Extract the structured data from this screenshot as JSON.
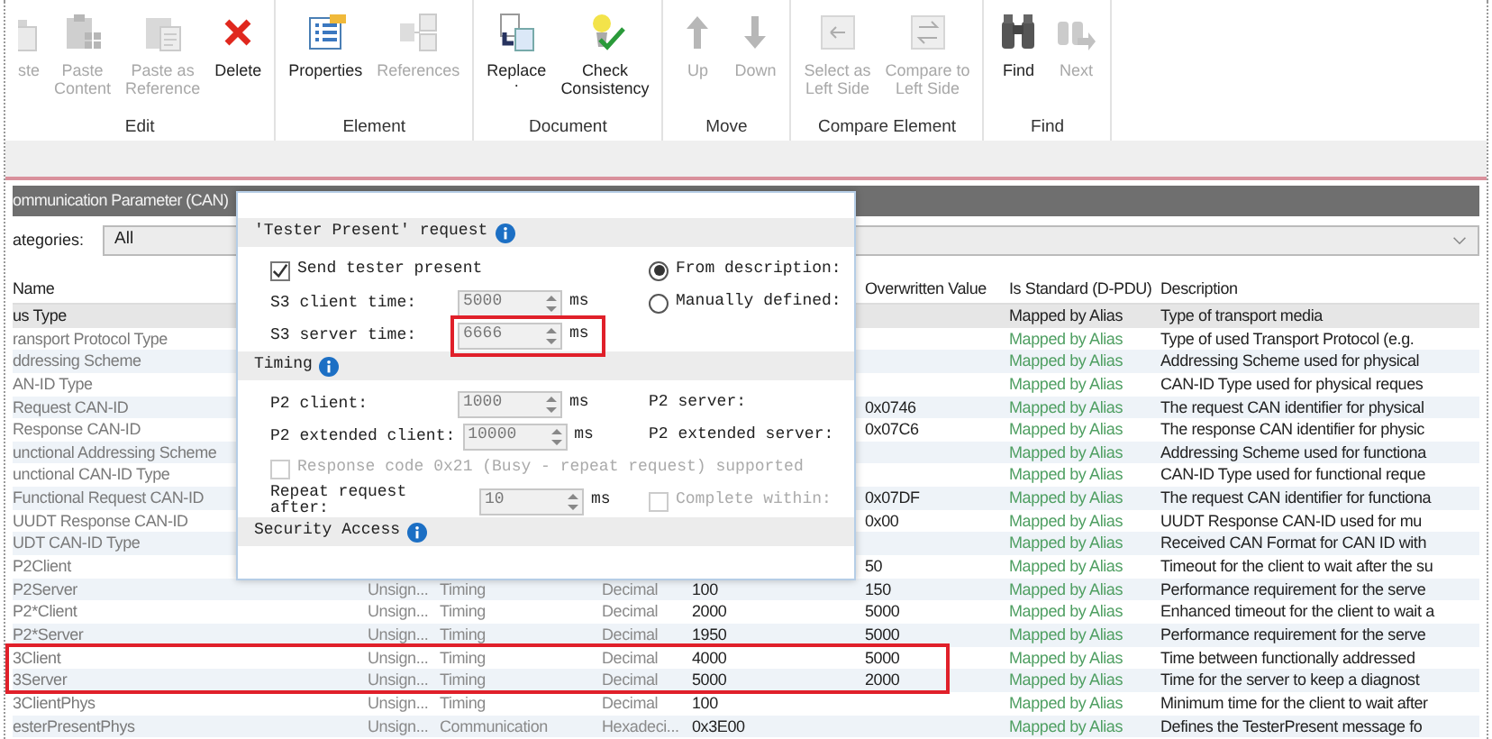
{
  "ribbon": {
    "groups": [
      {
        "label": "Edit",
        "buttons": [
          {
            "label": "ste",
            "disabled": true
          },
          {
            "label": "Paste\nContent",
            "disabled": true
          },
          {
            "label": "Paste as\nReference",
            "disabled": true
          },
          {
            "label": "Delete",
            "disabled": false
          }
        ]
      },
      {
        "label": "Element",
        "buttons": [
          {
            "label": "Properties",
            "disabled": false
          },
          {
            "label": "References",
            "disabled": true
          }
        ]
      },
      {
        "label": "Document",
        "buttons": [
          {
            "label": "Replace",
            "marker": "·",
            "disabled": false
          },
          {
            "label": "Check\nConsistency",
            "disabled": false
          }
        ]
      },
      {
        "label": "Move",
        "buttons": [
          {
            "label": "Up",
            "disabled": true
          },
          {
            "label": "Down",
            "disabled": true
          }
        ]
      },
      {
        "label": "Compare Element",
        "buttons": [
          {
            "label": "Select as\nLeft Side",
            "disabled": true
          },
          {
            "label": "Compare to\nLeft Side",
            "disabled": true
          }
        ]
      },
      {
        "label": "Find",
        "buttons": [
          {
            "label": "Find",
            "disabled": false
          },
          {
            "label": "Next",
            "disabled": true
          }
        ]
      }
    ]
  },
  "panel": {
    "title": "ommunication Parameter (CAN)",
    "categories_label": "ategories:",
    "categories_value": "All"
  },
  "table": {
    "columns": [
      "Name",
      "Overwritten Value",
      "Is Standard (D-PDU)",
      "Description"
    ],
    "rows": [
      {
        "name": "us Type",
        "standard": "Mapped by Alias",
        "description": "Type of transport media",
        "inherited": false,
        "selected": true
      },
      {
        "name": "ransport Protocol Type",
        "standard": "Mapped by Alias",
        "description": "Type of used Transport Protocol (e.g.",
        "inherited": true,
        "selected": false
      },
      {
        "name": "ddressing Scheme",
        "standard": "Mapped by Alias",
        "description": "Addressing Scheme used for physical",
        "inherited": true,
        "selected": false
      },
      {
        "name": "AN-ID Type",
        "standard": "Mapped by Alias",
        "description": "CAN-ID Type used for physical reques",
        "inherited": true,
        "selected": false
      },
      {
        "name": "Request CAN-ID",
        "overwritten": "0x0746",
        "standard": "Mapped by Alias",
        "description": "The request CAN identifier for physical",
        "inherited": true,
        "selected": false
      },
      {
        "name": "Response CAN-ID",
        "overwritten": "0x07C6",
        "standard": "Mapped by Alias",
        "description": "The response CAN identifier for physic",
        "inherited": true,
        "selected": false
      },
      {
        "name": "unctional Addressing Scheme",
        "standard": "Mapped by Alias",
        "description": "Addressing Scheme used for functiona",
        "inherited": true,
        "selected": false
      },
      {
        "name": "unctional CAN-ID Type",
        "standard": "Mapped by Alias",
        "description": "CAN-ID Type used for functional reque",
        "inherited": true,
        "selected": false
      },
      {
        "name": "Functional Request CAN-ID",
        "overwritten": "0x07DF",
        "standard": "Mapped by Alias",
        "description": "The request CAN identifier for functiona",
        "inherited": true,
        "selected": false
      },
      {
        "name": "UUDT Response CAN-ID",
        "overwritten": "0x00",
        "standard": "Mapped by Alias",
        "description": "UUDT Response CAN-ID used for mu",
        "inherited": true,
        "selected": false
      },
      {
        "name": "UDT CAN-ID Type",
        "standard": "Mapped by Alias",
        "description": "Received CAN Format for CAN ID with",
        "inherited": true,
        "selected": false
      },
      {
        "name": "P2Client",
        "overwritten": "50",
        "standard": "Mapped by Alias",
        "description": "Timeout for the client to wait after the su",
        "inherited": true,
        "selected": false
      },
      {
        "name": "P2Server",
        "type": "Unsign...",
        "category": "Timing",
        "format": "Decimal",
        "value": "100",
        "overwritten": "150",
        "standard": "Mapped by Alias",
        "description": "Performance requirement for the serve",
        "inherited": true,
        "selected": false
      },
      {
        "name": "P2*Client",
        "type": "Unsign...",
        "category": "Timing",
        "format": "Decimal",
        "value": "2000",
        "overwritten": "5000",
        "standard": "Mapped by Alias",
        "description": "Enhanced timeout for the client to wait a",
        "inherited": true,
        "selected": false
      },
      {
        "name": "P2*Server",
        "type": "Unsign...",
        "category": "Timing",
        "format": "Decimal",
        "value": "1950",
        "overwritten": "5000",
        "standard": "Mapped by Alias",
        "description": "Performance requirement for the serve",
        "inherited": true,
        "selected": false
      },
      {
        "name": "3Client",
        "type": "Unsign...",
        "category": "Timing",
        "format": "Decimal",
        "value": "4000",
        "overwritten": "5000",
        "standard": "Mapped by Alias",
        "description": "Time between functionally addressed",
        "inherited": true,
        "selected": false
      },
      {
        "name": "3Server",
        "type": "Unsign...",
        "category": "Timing",
        "format": "Decimal",
        "value": "5000",
        "overwritten": "2000",
        "standard": "Mapped by Alias",
        "description": "Time for the server to keep a diagnost",
        "inherited": true,
        "selected": false
      },
      {
        "name": "3ClientPhys",
        "type": "Unsign...",
        "category": "Timing",
        "format": "Decimal",
        "value": "100",
        "standard": "Mapped by Alias",
        "description": "Minimum time for the client to wait after",
        "inherited": true,
        "selected": false
      },
      {
        "name": "esterPresentPhys",
        "type": "Unsign...",
        "category": "Communication",
        "format": "Hexadeci...",
        "value": "0x3E00",
        "standard": "Mapped by Alias",
        "description": "Defines the TesterPresent message fo",
        "inherited": true,
        "selected": false
      }
    ]
  },
  "dialog": {
    "sections": [
      {
        "title": "'Tester Present' request",
        "rows": [
          [
            {
              "kind": "checkbox",
              "label": "Send tester present",
              "checked": true,
              "disabled": false
            },
            {
              "kind": "radio",
              "label": "From description:",
              "selected": true
            }
          ],
          [
            {
              "kind": "spin",
              "label": "S3 client time:",
              "value": "5000",
              "unit": "ms"
            },
            {
              "kind": "radio",
              "label": "Manually defined:",
              "selected": false
            }
          ],
          [
            {
              "kind": "spin",
              "label": "S3 server time:",
              "value": "6666",
              "unit": "ms"
            }
          ]
        ]
      },
      {
        "title": "Timing",
        "rows": [
          [
            {
              "kind": "spin",
              "label": "P2 client:",
              "value": "1000",
              "unit": "ms"
            },
            {
              "kind": "text",
              "label": "P2 server:"
            }
          ],
          [
            {
              "kind": "spin",
              "label": "P2 extended client:",
              "value": "10000",
              "unit": "ms"
            },
            {
              "kind": "text",
              "label": "P2 extended server:"
            }
          ],
          [
            {
              "kind": "checkbox",
              "label": "Response code 0x21 (Busy - repeat request) supported",
              "checked": false,
              "disabled": true
            }
          ],
          [
            {
              "kind": "spin",
              "label": "Repeat request after:",
              "value": "10",
              "unit": "ms"
            },
            {
              "kind": "checkbox",
              "label": "Complete within:",
              "checked": false,
              "disabled": true
            }
          ]
        ]
      },
      {
        "title": "Security Access"
      }
    ]
  }
}
